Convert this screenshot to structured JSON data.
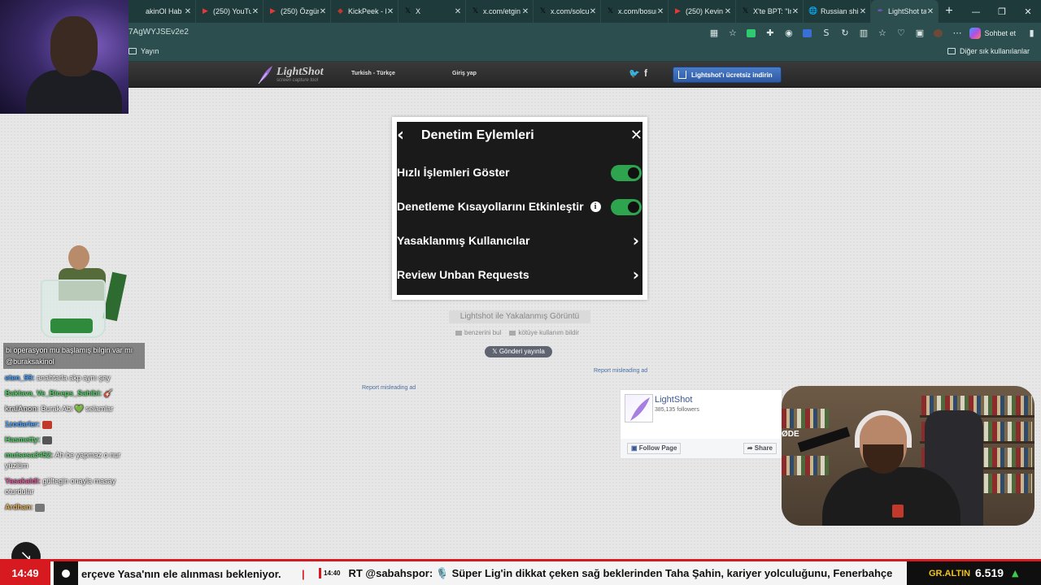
{
  "browser": {
    "tabs": [
      {
        "label": "akinOl Hab",
        "favicon": "",
        "favicon_color": "#1f3a3a"
      },
      {
        "label": "(250) YouTub",
        "favicon": "▶",
        "favicon_color": "#e53935"
      },
      {
        "label": "(250) Özgür",
        "favicon": "▶",
        "favicon_color": "#e53935"
      },
      {
        "label": "KickPeek - R",
        "favicon": "◆",
        "favicon_color": "#c0392b"
      },
      {
        "label": "X",
        "favicon": "𝕏",
        "favicon_color": "#000000"
      },
      {
        "label": "x.com/etgin",
        "favicon": "𝕏",
        "favicon_color": "#000000"
      },
      {
        "label": "x.com/solcu",
        "favicon": "𝕏",
        "favicon_color": "#000000"
      },
      {
        "label": "x.com/bosun",
        "favicon": "𝕏",
        "favicon_color": "#000000"
      },
      {
        "label": "(250) Kevin",
        "favicon": "▶",
        "favicon_color": "#e53935"
      },
      {
        "label": "X'te BPT: \"In",
        "favicon": "𝕏",
        "favicon_color": "#000000"
      },
      {
        "label": "Russian ship",
        "favicon": "🌐",
        "favicon_color": "#1f3a3a"
      },
      {
        "label": "LightShot ta",
        "favicon": "✒",
        "favicon_color": "#7e57c2"
      }
    ],
    "url": "7AgWYJSEv2e2",
    "chat_button": "Sohbet et",
    "bookmark_yayin": "Yayın",
    "bookmark_other": "Diğer sık kullanılanlar"
  },
  "site": {
    "logo_name": "LightShot",
    "logo_tagline": "screen capture tool",
    "language": "Turkish - Türkçe",
    "login": "Giriş yap",
    "download": "Lightshot'ı ücretsiz indirin"
  },
  "screenshot": {
    "title": "Denetim Eylemleri",
    "rows": [
      {
        "label": "Hızlı İşlemleri Göster",
        "control": "toggle",
        "on": true
      },
      {
        "label": "Denetleme Kısayollarını Etkinleştir",
        "control": "toggle",
        "on": true,
        "info": "i"
      },
      {
        "label": "Yasaklanmış Kullanıcılar",
        "control": "chevron"
      },
      {
        "label": "Review Unban Requests",
        "control": "chevron"
      }
    ]
  },
  "caption": "Lightshot ile Yakalanmış Görüntü",
  "actions": {
    "similar": "benzerini bul",
    "report": "kötüye kullanım bildir"
  },
  "tweet_button": "Gönderi yayınla",
  "report_ad_label": "Report misleading ad",
  "fb_widget": {
    "name": "LightShot",
    "followers": "385,135 followers",
    "follow": "Follow Page",
    "share": "Share"
  },
  "chat": {
    "highlight": "bi operasyon mu başlamış bilgin var mı @buraksakinol",
    "messages": [
      {
        "user": "eten_99:",
        "text": "anahtarla akp aynı şey",
        "color": "#4aa3ff"
      },
      {
        "user": "Baklava_Ve_Biceps_Sahibi:",
        "text": "🎸",
        "color": "#58d26b"
      },
      {
        "user": "kralAnon:",
        "text": "Burak Abi 💚 selamlar",
        "color": "#d9d9d9"
      },
      {
        "user": "1zodarler:",
        "text": "",
        "color": "#4aa3ff",
        "emote": "#c0392b"
      },
      {
        "user": "Hasmetty:",
        "text": "",
        "color": "#58d26b",
        "emote": "#555555"
      },
      {
        "user": "mutsesa3452:",
        "text": "Ah be yapmaz o nur yüzlüm",
        "color": "#58d26b"
      },
      {
        "user": "Yasakaldi:",
        "text": "gültegin onayla masay oturdular",
        "color": "#e05a9a"
      },
      {
        "user": "Ardhan:",
        "text": "",
        "color": "#e5b35a",
        "emote": "#777777"
      }
    ]
  },
  "stream": {
    "cam_logo": "ØDE"
  },
  "ticker": {
    "time": "14:49",
    "headline_1": "erçeve Yasa'nın ele alınması bekleniyor.",
    "separator": "|",
    "item_time": "14:40",
    "headline_2": "RT @sabahspor: 🎙️ Süper Lig'in dikkat çeken sağ beklerinden Taha Şahin, kariyer yolculuğunu, Fenerbahçe",
    "gold_label": "GR.ALTIN",
    "gold_value": "6.519",
    "gold_arrow": "▲"
  }
}
